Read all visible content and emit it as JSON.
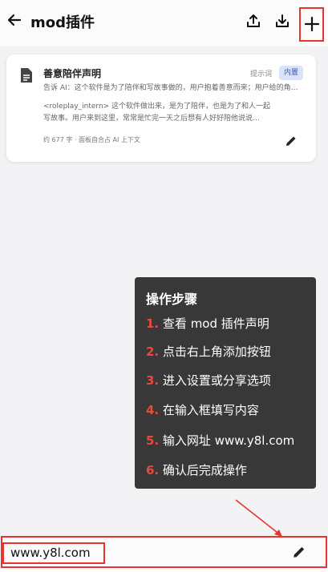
{
  "header": {
    "title": "mod插件"
  },
  "card": {
    "title": "善意陪伴声明",
    "tag": "提示词",
    "badge": "内置",
    "line1": "告诉 AI：这个软件是为了陪伴和写故事做的，用户抱着善意而来；用户给的角…",
    "line2": "<roleplay_intern> 这个软件做出来，是为了陪伴，也是为了和人一起",
    "line3": "写故事。用户来到这里，常常是忙完一天之后想有人好好陪他说说…",
    "meta": "约 677 字 · 面板自合占 AI 上下文"
  },
  "overlay": {
    "title": "操作步骤",
    "steps": [
      {
        "num": "1.",
        "text": "查看 mod 插件声明"
      },
      {
        "num": "2.",
        "text": "点击右上角添加按钮"
      },
      {
        "num": "3.",
        "text": "进入设置或分享选项"
      },
      {
        "num": "4.",
        "text": "在输入框填写内容"
      },
      {
        "num": "5.",
        "text": "输入网址 www.y8l.com"
      },
      {
        "num": "6.",
        "text": "确认后完成操作"
      }
    ]
  },
  "bottom": {
    "url": "www.y8l.com"
  },
  "colors": {
    "accent_red": "#e8332f",
    "badge_bg": "#dbe3fb",
    "badge_text": "#3a56b8",
    "overlay_bg": "#383838"
  },
  "icons": [
    "back-arrow-icon",
    "upload-icon",
    "download-icon",
    "plus-icon",
    "document-icon",
    "pencil-icon"
  ]
}
